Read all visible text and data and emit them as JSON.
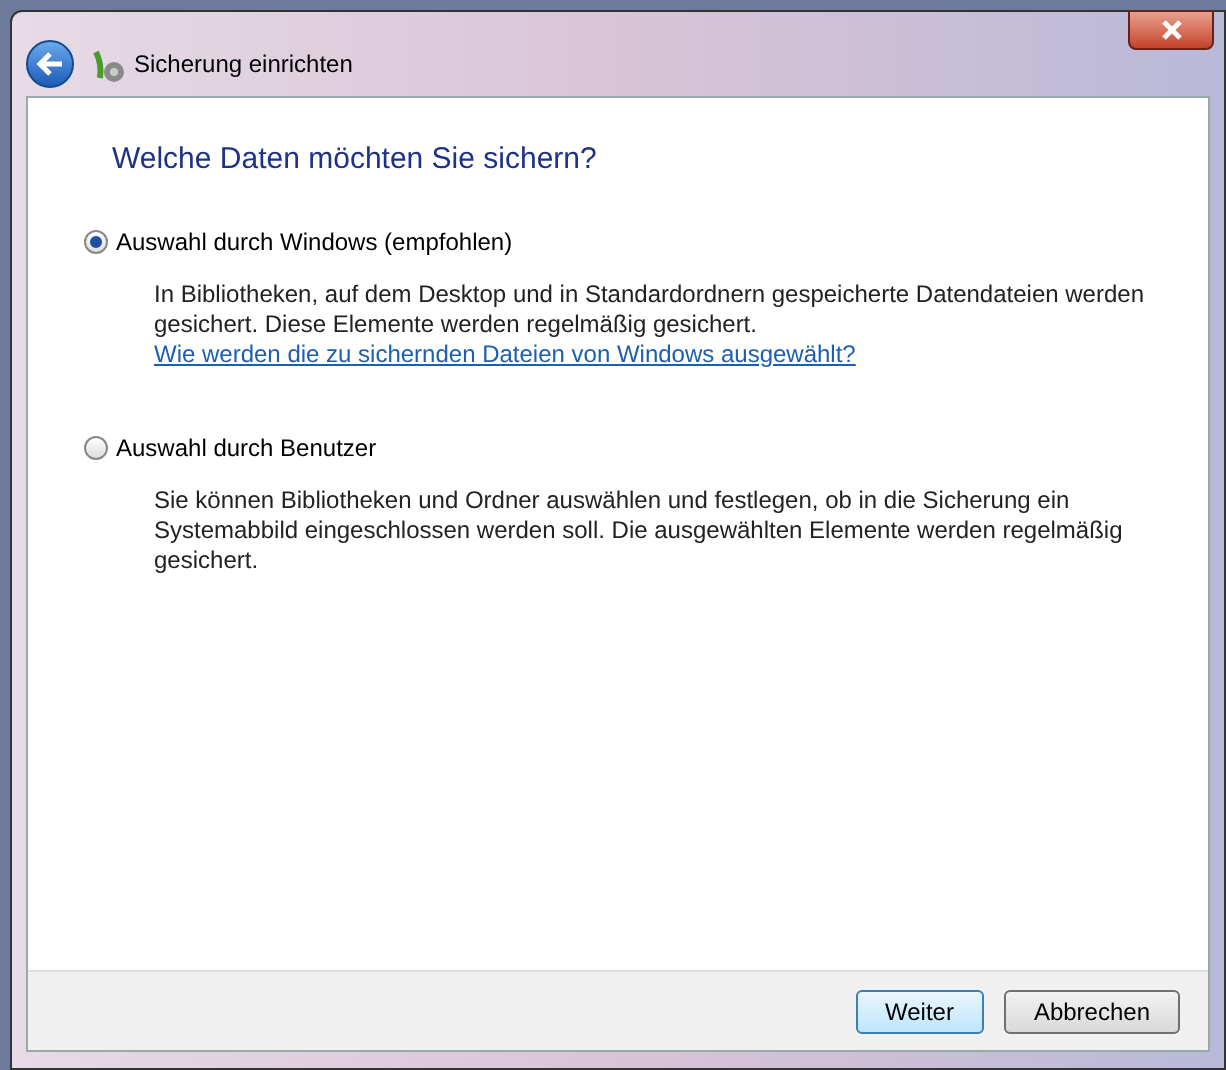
{
  "window": {
    "title": "Sicherung einrichten"
  },
  "heading": "Welche Daten möchten Sie sichern?",
  "options": [
    {
      "label": "Auswahl durch Windows (empfohlen)",
      "selected": true,
      "description": "In Bibliotheken, auf dem Desktop und in Standardordnern gespeicherte Datendateien werden gesichert. Diese Elemente werden regelmäßig gesichert.",
      "link": "Wie werden die zu sichernden Dateien von Windows ausgewählt?"
    },
    {
      "label": "Auswahl durch Benutzer",
      "selected": false,
      "description": "Sie können Bibliotheken und Ordner auswählen und festlegen, ob in die Sicherung ein Systemabbild eingeschlossen werden soll. Die ausgewählten Elemente werden regelmäßig gesichert."
    }
  ],
  "buttons": [
    {
      "label": "Weiter",
      "kind": "default"
    },
    {
      "label": "Abbrechen",
      "kind": "normal"
    }
  ]
}
